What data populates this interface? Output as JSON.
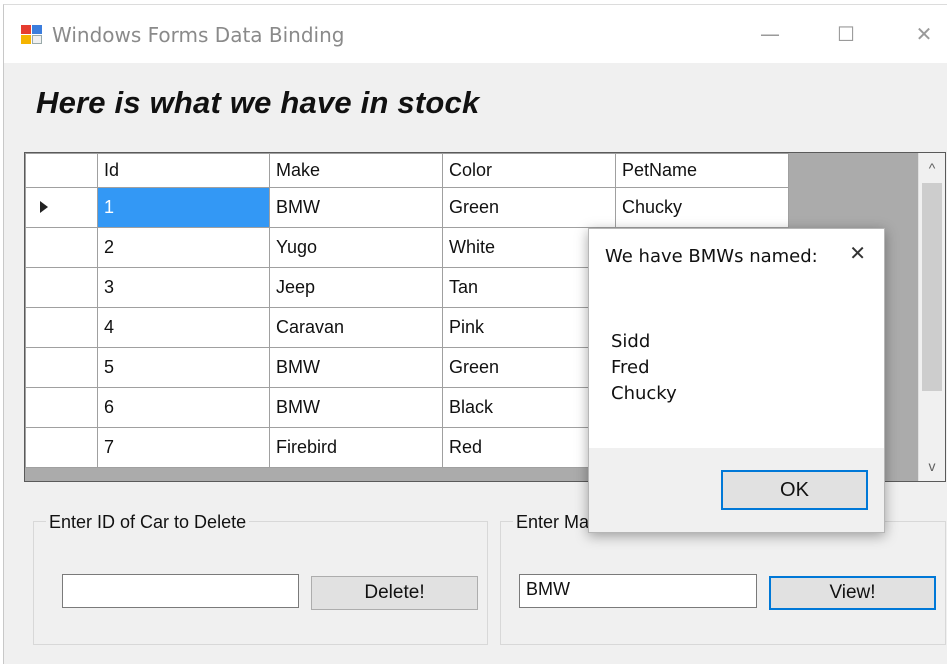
{
  "window": {
    "title": "Windows Forms Data Binding",
    "minimize_glyph": "—",
    "maximize_glyph": "☐",
    "close_glyph": "✕"
  },
  "heading": "Here is what we have in stock",
  "grid": {
    "columns": [
      "Id",
      "Make",
      "Color",
      "PetName"
    ],
    "rows": [
      {
        "id": "1",
        "make": "BMW",
        "color": "Green",
        "petname": "Chucky"
      },
      {
        "id": "2",
        "make": "Yugo",
        "color": "White",
        "petname": ""
      },
      {
        "id": "3",
        "make": "Jeep",
        "color": "Tan",
        "petname": ""
      },
      {
        "id": "4",
        "make": "Caravan",
        "color": "Pink",
        "petname": ""
      },
      {
        "id": "5",
        "make": "BMW",
        "color": "Green",
        "petname": ""
      },
      {
        "id": "6",
        "make": "BMW",
        "color": "Black",
        "petname": ""
      },
      {
        "id": "7",
        "make": "Firebird",
        "color": "Red",
        "petname": ""
      }
    ],
    "selected_row": 1,
    "scroll_up_glyph": "^",
    "scroll_down_glyph": "v"
  },
  "delete_group": {
    "label": "Enter ID of Car to Delete",
    "input_value": "",
    "button_label": "Delete!"
  },
  "view_group": {
    "label": "Enter Ma",
    "input_value": "BMW",
    "button_label": "View!"
  },
  "dialog": {
    "title": "We have BMWs named:",
    "close_glyph": "✕",
    "names": [
      "Sidd",
      "Fred",
      "Chucky"
    ],
    "ok_label": "OK"
  },
  "colors": {
    "selection": "#3398f5",
    "focus_border": "#0078d7",
    "window_bg": "#f0f0f0",
    "grid_empty": "#ababab"
  }
}
